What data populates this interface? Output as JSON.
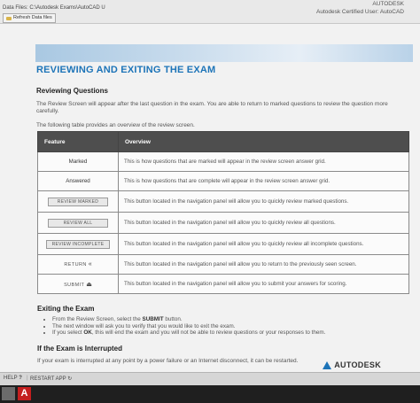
{
  "topbar": {
    "data_files": "Data Files: C:\\Autodesk Exams\\AutoCAD U",
    "refresh_label": "Refresh Data files",
    "brand": "AUTODESK",
    "certified_user": "Autodesk Certified User: AutoCAD"
  },
  "page": {
    "title": "REVIEWING AND EXITING THE EXAM",
    "section1_heading": "Reviewing Questions",
    "para1": "The Review Screen will appear after the last question in the exam. You are able to return to marked questions to review the question more carefully.",
    "para2": "The following table provides an overview of the review screen.",
    "section2_heading": "Exiting the Exam",
    "section3_heading": "If the Exam is Interrupted",
    "para3": "If your exam is interrupted at any point by a power failure or an Internet disconnect, it can be restarted."
  },
  "table": {
    "headers": [
      "Feature",
      "Overview"
    ],
    "rows": [
      {
        "feature": "Marked",
        "kind": "text",
        "overview": "This is how questions that are marked will appear in the review screen answer grid."
      },
      {
        "feature": "Answered",
        "kind": "text",
        "overview": "This is how questions that are complete will appear in the review screen answer grid."
      },
      {
        "feature": "REVIEW MARKED",
        "kind": "button",
        "overview": "This button located in the navigation panel will allow you to quickly review marked questions."
      },
      {
        "feature": "REVIEW ALL",
        "kind": "button",
        "overview": "This button located in the navigation panel will allow you to quickly review all questions."
      },
      {
        "feature": "REVIEW INCOMPLETE",
        "kind": "button",
        "overview": "This button located in the navigation panel will allow you to quickly review all incomplete questions."
      },
      {
        "feature": "RETURN",
        "kind": "nav",
        "symbol": "«",
        "overview": "This button located in the navigation panel will allow you to return to the previously seen screen."
      },
      {
        "feature": "SUBMIT",
        "kind": "nav",
        "symbol": "⏏",
        "overview": "This button located in the navigation panel will allow you to submit your answers for scoring."
      }
    ]
  },
  "exit_list": {
    "item1_pre": "From the Review Screen, select the ",
    "item1_btn": "SUBMIT",
    "item1_post": " button.",
    "item2": "The next window will ask you to verify that you would like to exit the exam.",
    "item3_pre": "If you select ",
    "item3_btn": "OK",
    "item3_post": ", this will end the exam and you will not be able to review questions or your responses to them."
  },
  "logo": {
    "text": "AUTODESK"
  },
  "footer": {
    "help": "HELP",
    "help_icon": "?",
    "restart": "RESTART APP",
    "restart_icon": "↻"
  },
  "colors": {
    "title_blue": "#1d74b8",
    "header_dark": "#4e4e4e"
  }
}
